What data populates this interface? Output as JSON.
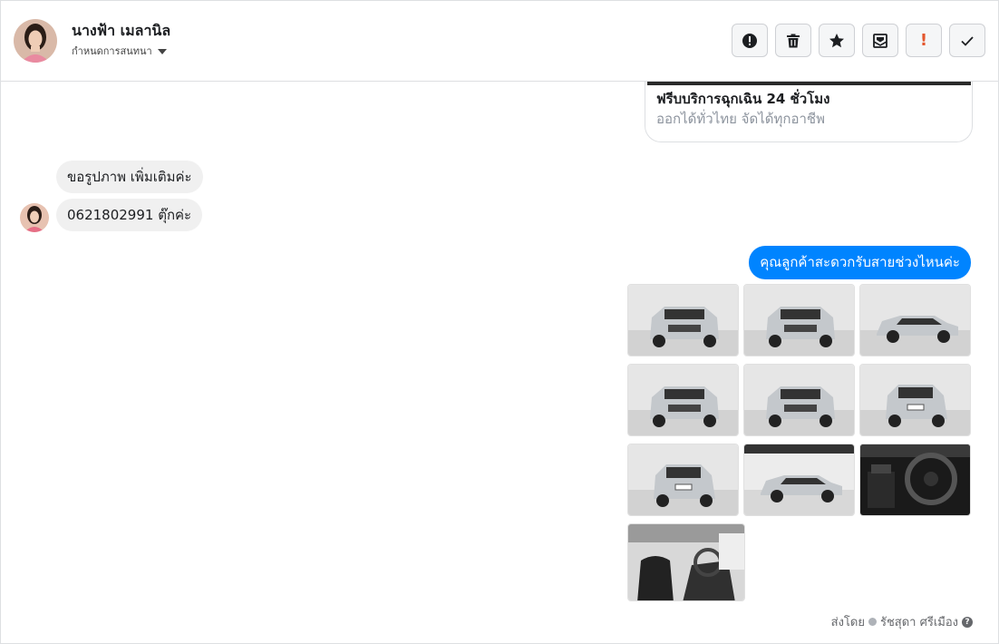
{
  "header": {
    "contact_name": "นางฟ้า เมลานิล",
    "assign_label": "กำหนดการสนทนา",
    "tools": [
      {
        "name": "mark-spam",
        "icon": "exclamation-circle-icon"
      },
      {
        "name": "delete",
        "icon": "trash-icon"
      },
      {
        "name": "star",
        "icon": "star-icon"
      },
      {
        "name": "mark-unread",
        "icon": "envelope-icon"
      },
      {
        "name": "follow-up",
        "icon": "exclamation-mark-icon",
        "glyph": "!",
        "color": "#e4572e"
      },
      {
        "name": "mark-done",
        "icon": "checkmark-icon"
      }
    ]
  },
  "card": {
    "title": "ฟรีบบริการฉุกเฉิน 24 ชั่วโมง",
    "subtitle": "ออกได้ทั่วไทย จัดได้ทุกอาชีพ"
  },
  "messages_in": [
    {
      "text": "ขอรูปภาพ เพิ่มเติมค่ะ"
    },
    {
      "text": "0621802991 ตุ๊กค่ะ"
    }
  ],
  "message_out": {
    "text": "คุณลูกค้าสะดวกรับสายช่วงไหนค่ะ",
    "color": "#0084ff"
  },
  "photos": [
    {
      "alt": "car-front-left"
    },
    {
      "alt": "car-front"
    },
    {
      "alt": "car-side-right"
    },
    {
      "alt": "car-front-left-2"
    },
    {
      "alt": "car-front-2"
    },
    {
      "alt": "car-rear-right"
    },
    {
      "alt": "car-rear-left"
    },
    {
      "alt": "car-side-far"
    },
    {
      "alt": "car-dashboard"
    },
    {
      "alt": "car-interior-seat"
    }
  ],
  "footer": {
    "sent_by_label": "ส่งโดย",
    "sender_name": "รัชสุดา ศรีเมือง"
  }
}
